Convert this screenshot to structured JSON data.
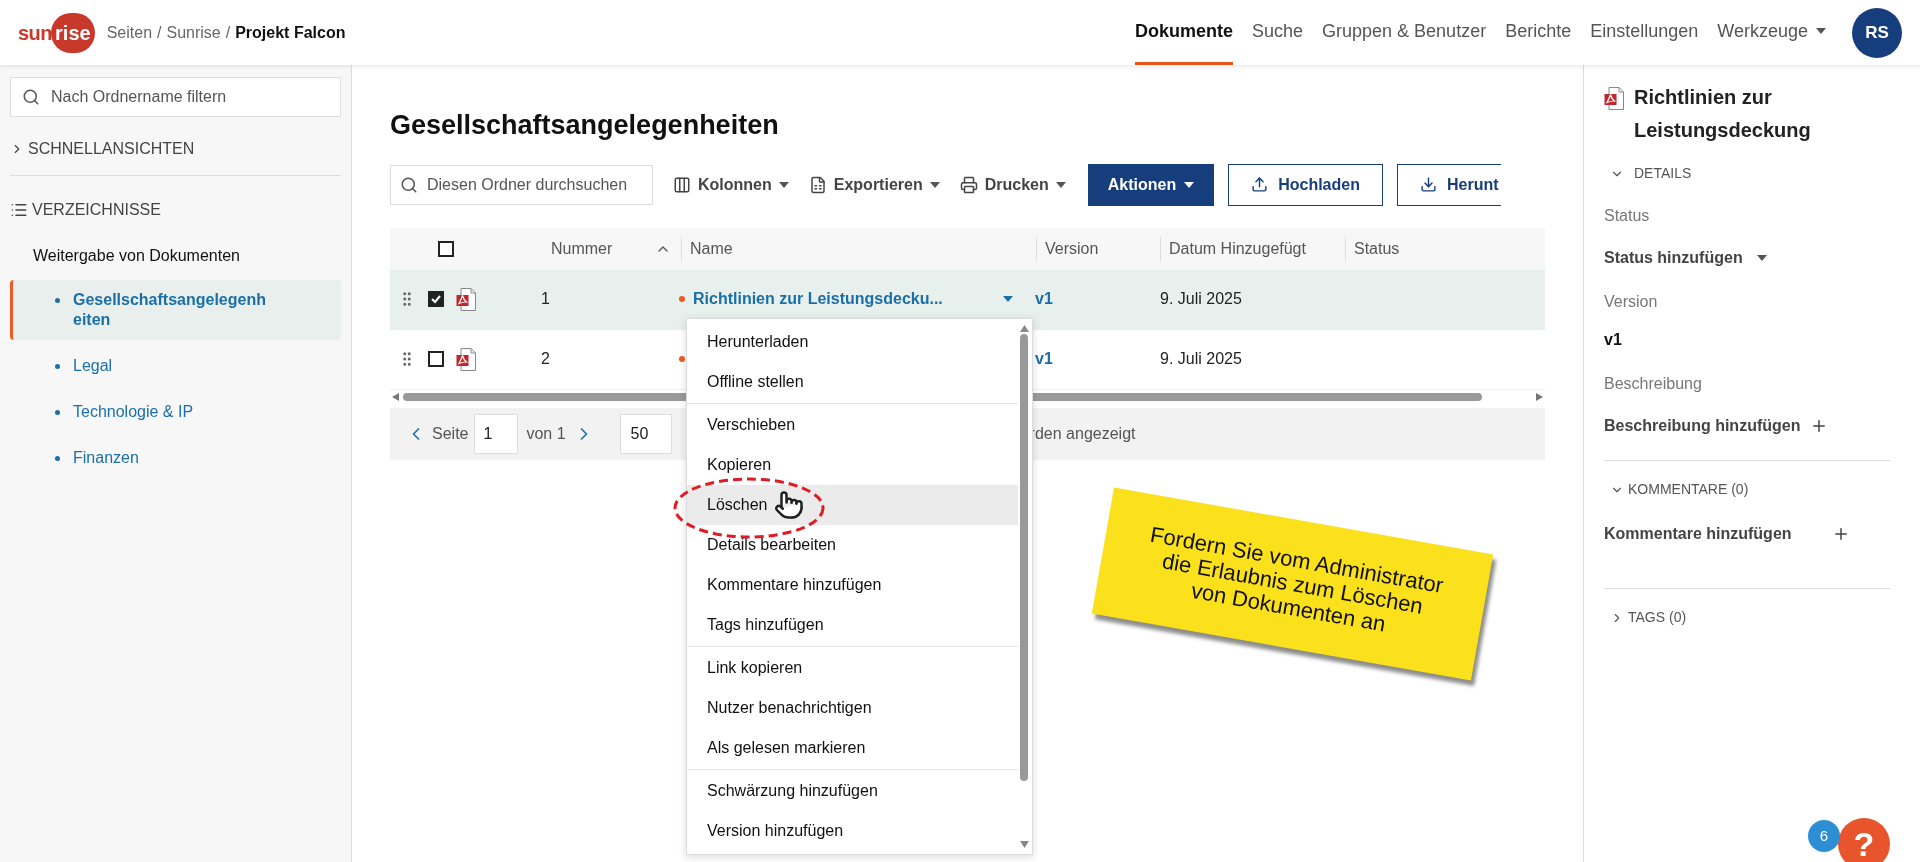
{
  "header": {
    "logo": {
      "part_1": "sun",
      "part_2": "rise"
    },
    "breadcrumb": [
      {
        "label": "Seiten",
        "kind": "link"
      },
      {
        "label": "/",
        "kind": "separator"
      },
      {
        "label": "Sunrise",
        "kind": "link"
      },
      {
        "label": "/",
        "kind": "separator"
      },
      {
        "label": "Projekt Falcon",
        "kind": "current"
      }
    ],
    "nav": [
      {
        "label": "Dokumente",
        "selected": true,
        "kind": "link"
      },
      {
        "label": "Suche",
        "selected": false,
        "kind": "link"
      },
      {
        "label": "Gruppen & Benutzer",
        "selected": false,
        "kind": "link"
      },
      {
        "label": "Berichte",
        "selected": false,
        "kind": "link"
      },
      {
        "label": "Einstellungen",
        "selected": false,
        "kind": "link"
      },
      {
        "label": "Werkzeuge",
        "selected": false,
        "kind": "dropdown"
      }
    ],
    "avatar": "RS"
  },
  "sidebar": {
    "filter_placeholder": "Nach Ordnername filtern",
    "quick_views": {
      "label": "SCHNELLANSICHTEN",
      "expanded": false
    },
    "directories": {
      "label": "VERZEICHNISSE",
      "root": "Weitergabe von Dokumenten",
      "children": [
        {
          "label": "Gesellschaftsangelegenheiten",
          "selected": true
        },
        {
          "label": "Legal",
          "selected": false
        },
        {
          "label": "Technologie & IP",
          "selected": false
        },
        {
          "label": "Finanzen",
          "selected": false
        }
      ]
    }
  },
  "main": {
    "title": "Gesellschaftsangelegenheiten",
    "toolbar": {
      "search_placeholder": "Diesen Ordner durchsuchen",
      "tools": [
        {
          "label": "Kolonnen",
          "kind": "columns"
        },
        {
          "label": "Exportieren",
          "kind": "export"
        },
        {
          "label": "Drucken",
          "kind": "print"
        }
      ],
      "buttons": [
        {
          "label": "Aktionen",
          "kind": "primary"
        },
        {
          "label": "Hochladen",
          "kind": "upload"
        },
        {
          "label": "Herunt",
          "kind": "download"
        }
      ]
    },
    "table": {
      "all_checked": false,
      "columns": [
        {
          "label": "Nummer",
          "sorted": true
        },
        {
          "label": "Name",
          "sorted": false
        },
        {
          "label": "Version",
          "sorted": false
        },
        {
          "label": "Datum Hinzugefügt",
          "sorted": false
        },
        {
          "label": "Status",
          "sorted": false
        }
      ],
      "rows": [
        {
          "number": "1",
          "name": "Richtlinien zur Leistungsdecku...",
          "version": "v1",
          "date": "9. Juli 2025",
          "checked": true,
          "selected": true
        },
        {
          "number": "2",
          "version": "v1",
          "date": "9. Juli 2025",
          "checked": false,
          "selected": false
        }
      ]
    },
    "pagination": {
      "page_label": "Seite",
      "page": "1",
      "of": "von 1",
      "page_size": "50",
      "summary": "rden angezeigt"
    }
  },
  "context_menu": {
    "groups": [
      {
        "items": [
          {
            "label": "Herunterladen",
            "highlighted": false
          },
          {
            "label": "Offline stellen",
            "highlighted": false
          }
        ]
      },
      {
        "items": [
          {
            "label": "Verschieben",
            "highlighted": false
          },
          {
            "label": "Kopieren",
            "highlighted": false
          },
          {
            "label": "Löschen",
            "highlighted": true
          },
          {
            "label": "Details bearbeiten",
            "highlighted": false
          },
          {
            "label": "Kommentare hinzufügen",
            "highlighted": false
          },
          {
            "label": "Tags hinzufügen",
            "highlighted": false
          }
        ]
      },
      {
        "items": [
          {
            "label": "Link kopieren",
            "highlighted": false
          },
          {
            "label": "Nutzer benachrichtigen",
            "highlighted": false
          },
          {
            "label": "Als gelesen markieren",
            "highlighted": false
          }
        ]
      },
      {
        "items": [
          {
            "label": "Schwärzung hinzufügen",
            "highlighted": false
          },
          {
            "label": "Version hinzufügen",
            "highlighted": false
          }
        ]
      }
    ]
  },
  "details_panel": {
    "title": "Richtlinien zur Leistungsdeckung",
    "details": {
      "label": "DETAILS",
      "expanded": true,
      "fields": [
        {
          "label": "Status",
          "value": "Status hinzufügen",
          "kind": "dropdown"
        },
        {
          "label": "Version",
          "value": "v1",
          "kind": "text"
        },
        {
          "label": "Beschreibung",
          "value": "Beschreibung hinzufügen",
          "kind": "add"
        }
      ]
    },
    "comments": {
      "label": "KOMMENTARE (0)",
      "expanded": true,
      "action": "Kommentare hinzufügen"
    },
    "tags": {
      "label": "TAGS (0)",
      "expanded": false
    }
  },
  "annotation": {
    "note_lines": [
      "Fordern Sie vom Administrator",
      "die Erlaubnis zum Löschen",
      "von Dokumenten an"
    ]
  },
  "help": {
    "label": "?",
    "badge": "6"
  }
}
